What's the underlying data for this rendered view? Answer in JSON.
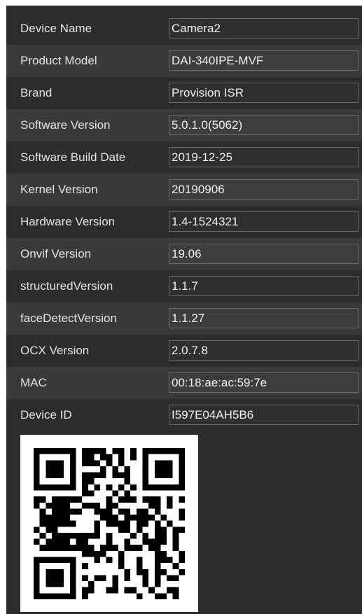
{
  "fields": [
    {
      "label": "Device Name",
      "value": "Camera2"
    },
    {
      "label": "Product Model",
      "value": "DAI-340IPE-MVF"
    },
    {
      "label": "Brand",
      "value": "Provision ISR"
    },
    {
      "label": "Software Version",
      "value": "5.0.1.0(5062)"
    },
    {
      "label": "Software Build Date",
      "value": "2019-12-25"
    },
    {
      "label": "Kernel Version",
      "value": "20190906"
    },
    {
      "label": "Hardware Version",
      "value": "1.4-1524321"
    },
    {
      "label": "Onvif Version",
      "value": "19.06"
    },
    {
      "label": "structuredVersion",
      "value": "1.1.7"
    },
    {
      "label": "faceDetectVersion",
      "value": "1.1.27"
    },
    {
      "label": "OCX Version",
      "value": "2.0.7.8"
    },
    {
      "label": "MAC",
      "value": "00:18:ae:ac:59:7e"
    },
    {
      "label": "Device ID",
      "value": "I597E04AH5B6"
    }
  ],
  "qr_code": {
    "icon": "qr-code-icon",
    "colors": {
      "dark": "#000000",
      "light": "#ffffff"
    }
  },
  "colors": {
    "panel_bg": "#2c2c2c",
    "row_alt_bg": "#3a3a3a",
    "label_text": "#e3e3e3",
    "field_border": "#6a6a6a",
    "field_text": "#f0f0f0"
  }
}
